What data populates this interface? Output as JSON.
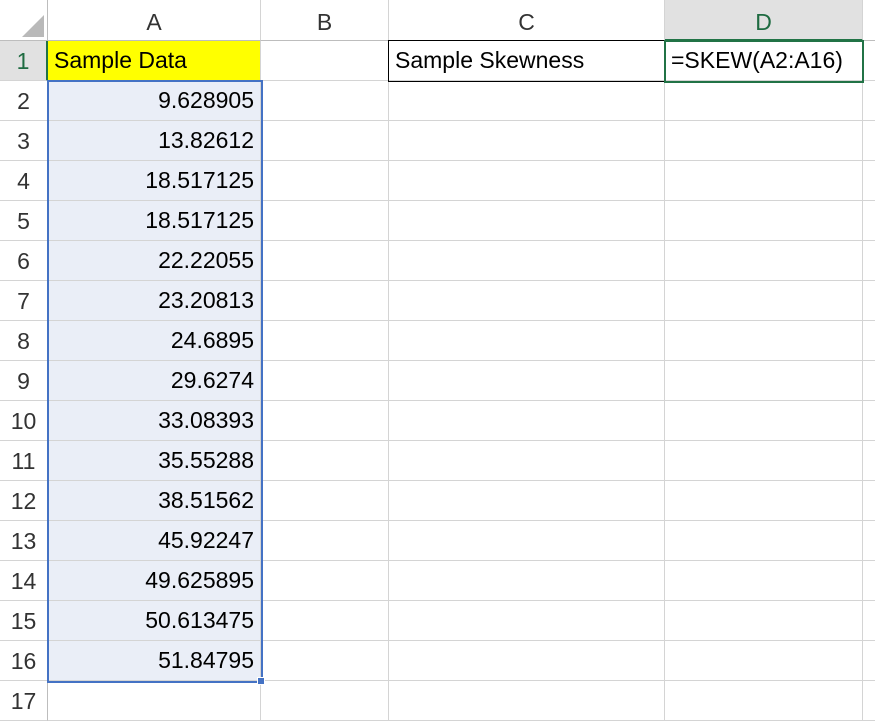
{
  "columns": [
    "A",
    "B",
    "C",
    "D"
  ],
  "rows": [
    "1",
    "2",
    "3",
    "4",
    "5",
    "6",
    "7",
    "8",
    "9",
    "10",
    "11",
    "12",
    "13",
    "14",
    "15",
    "16",
    "17"
  ],
  "cells": {
    "A1": "Sample Data",
    "C1": "Sample Skewness",
    "D1": "=SKEW(A2:A16)",
    "A_values": [
      "9.628905",
      "13.82612",
      "18.517125",
      "18.517125",
      "22.22055",
      "23.20813",
      "24.6895",
      "29.6274",
      "33.08393",
      "35.55288",
      "38.51562",
      "45.92247",
      "49.625895",
      "50.613475",
      "51.84795"
    ]
  },
  "selection": {
    "active_cell": "D1",
    "highlighted_range": "A2:A16"
  },
  "colors": {
    "header_yellow": "#ffff00",
    "range_blue": "#4472c4",
    "active_green": "#217346",
    "range_fill": "#eaeef7"
  }
}
